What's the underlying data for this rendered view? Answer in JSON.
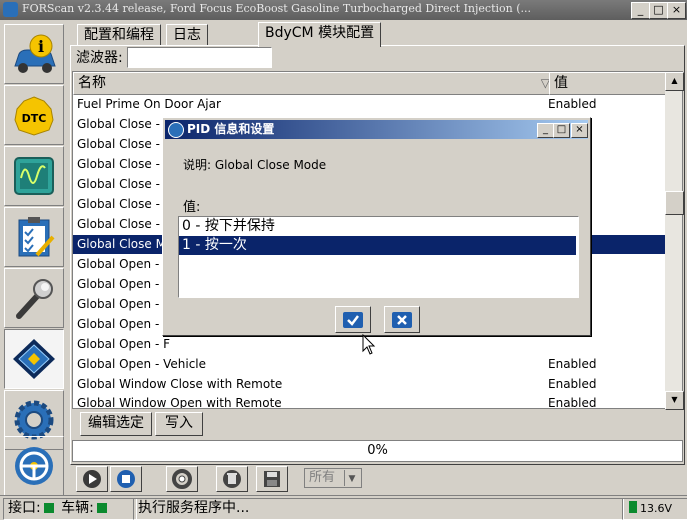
{
  "window": {
    "title": "FORScan v2.3.44 release, Ford Focus EcoBoost Gasoline Turbocharged Direct Injection (...",
    "minimize": "_",
    "maximize": "□",
    "close": "×"
  },
  "tabs": [
    {
      "label": "配置和编程"
    },
    {
      "label": "日志"
    },
    {
      "label": "BdyCM 模块配置"
    }
  ],
  "filter": {
    "label": "滤波器:",
    "value": ""
  },
  "table": {
    "columns": [
      "名称",
      "值"
    ],
    "rows": [
      {
        "name": "Fuel Prime On Door Ajar",
        "value": "Enabled"
      },
      {
        "name": "Global Close - S",
        "value": ""
      },
      {
        "name": "Global Close - I",
        "value": ""
      },
      {
        "name": "Global Close - I",
        "value": ""
      },
      {
        "name": "Global Close - I",
        "value": ""
      },
      {
        "name": "Global Close - I",
        "value": ""
      },
      {
        "name": "Global Close - V",
        "value": ""
      },
      {
        "name": "Global Close M",
        "value": ""
      },
      {
        "name": "Global Open - I",
        "value": ""
      },
      {
        "name": "Global Open - F",
        "value": ""
      },
      {
        "name": "Global Open - F",
        "value": ""
      },
      {
        "name": "Global Open - F",
        "value": ""
      },
      {
        "name": "Global Open - F",
        "value": ""
      },
      {
        "name": "Global Open - Vehicle",
        "value": "Enabled"
      },
      {
        "name": "Global Window Close with Remote",
        "value": "Enabled"
      },
      {
        "name": "Global Window Open with Remote",
        "value": "Enabled"
      }
    ],
    "selected_index": 7
  },
  "buttons": {
    "edit": "编辑选定",
    "write": "写入"
  },
  "progress": {
    "text": "0%",
    "value": 0
  },
  "combo": {
    "value": "所有"
  },
  "status": {
    "port_label": "接口:",
    "vehicle_label": "车辆:",
    "message": "执行服务程序中...",
    "voltage": "13.6V"
  },
  "dialog": {
    "title": "PID 信息和设置",
    "description": "说明: Global Close Mode",
    "value_label": "值:",
    "options": [
      {
        "label": "0 - 按下并保持"
      },
      {
        "label": "1 - 按一次"
      }
    ],
    "selected_index": 1,
    "minimize": "_",
    "maximize": "□",
    "close": "×"
  },
  "icons": [
    "info-car-icon",
    "dtc-icon",
    "oscilloscope-icon",
    "checklist-icon",
    "wrench-icon",
    "chip-icon",
    "gear-icon",
    "steering-wheel-icon"
  ],
  "colors": {
    "selection": "#0a246a",
    "status_ok": "#0b8a2e"
  }
}
